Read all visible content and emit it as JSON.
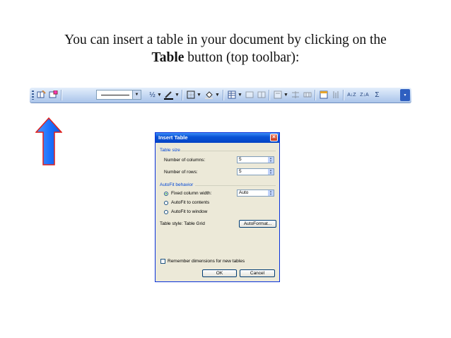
{
  "heading": {
    "line1": "You can insert a table in your document by clicking on the",
    "bold": "Table",
    "line2_rest": " button (top toolbar):"
  },
  "toolbar": {
    "fraction_label": "½",
    "sort_asc_label": "A↓Z",
    "sort_desc_label": "Z↓A",
    "sum_label": "Σ"
  },
  "dialog": {
    "title": "Insert Table",
    "close_label": "×",
    "table_size_label": "Table size",
    "columns_label": "Number of columns:",
    "columns_value": "5",
    "rows_label": "Number of rows:",
    "rows_value": "5",
    "autofit_label": "AutoFit behavior",
    "fixed_width_label": "Fixed column width:",
    "fixed_width_value": "Auto",
    "autofit_contents_label": "AutoFit to contents",
    "autofit_window_label": "AutoFit to window",
    "table_style_label": "Table style: Table Grid",
    "autoformat_label": "AutoFormat...",
    "remember_label": "Remember dimensions for new tables",
    "ok_label": "OK",
    "cancel_label": "Cancel"
  },
  "colors": {
    "toolbar_blue": "#c3d7f2",
    "dialog_title": "#0a53d6",
    "arrow_blue": "#1e73ff",
    "arrow_outline": "#e0201b"
  }
}
